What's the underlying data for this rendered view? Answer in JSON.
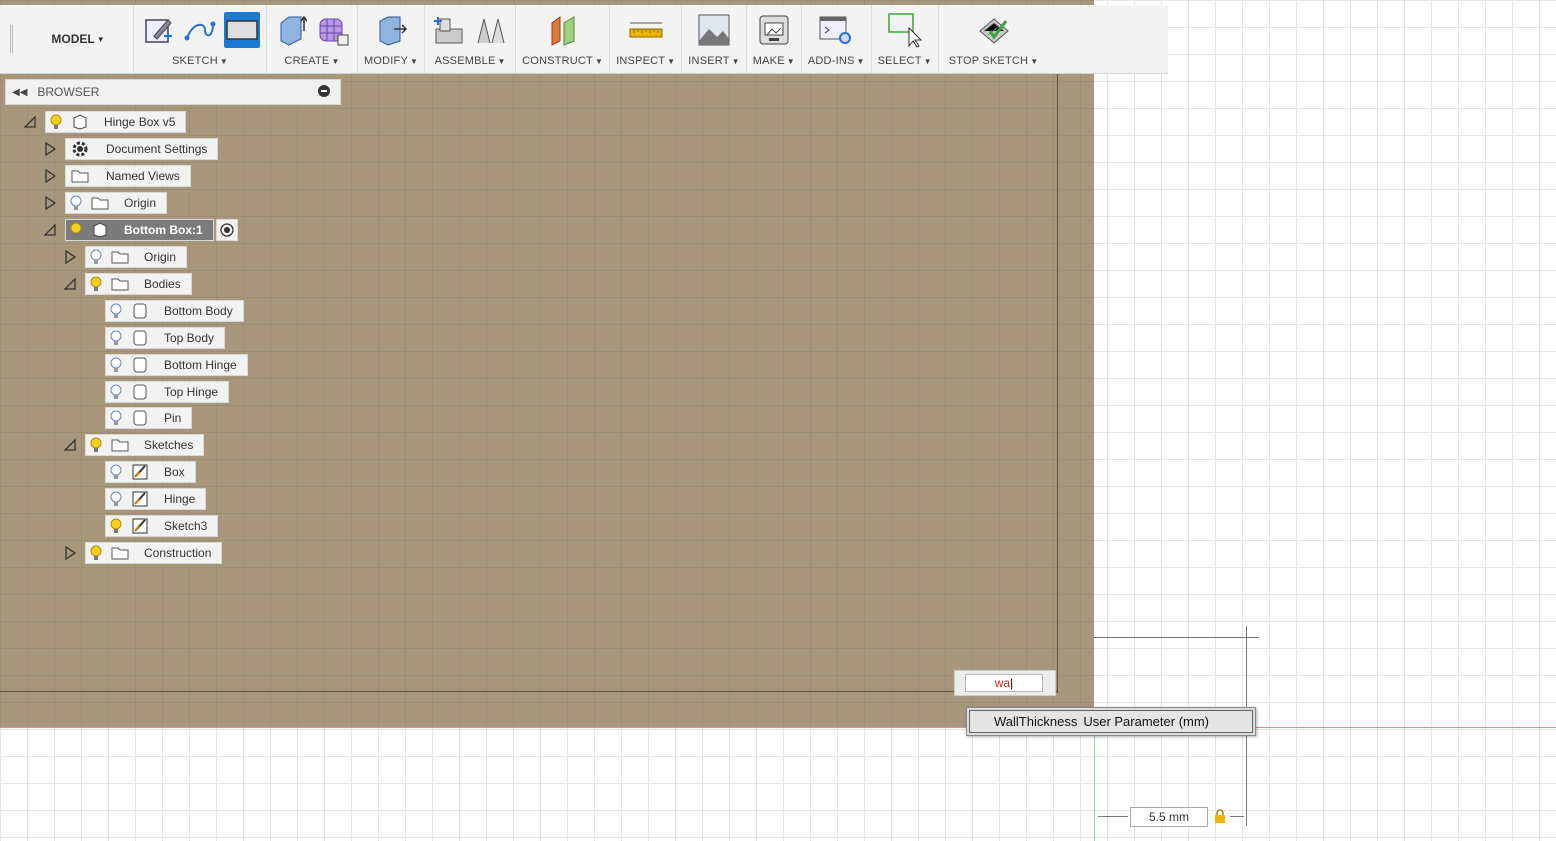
{
  "toolbar": {
    "workspace": "MODEL",
    "groups": [
      {
        "label": "SKETCH"
      },
      {
        "label": "CREATE"
      },
      {
        "label": "MODIFY"
      },
      {
        "label": "ASSEMBLE"
      },
      {
        "label": "CONSTRUCT"
      },
      {
        "label": "INSPECT"
      },
      {
        "label": "INSERT"
      },
      {
        "label": "MAKE"
      },
      {
        "label": "ADD-INS"
      },
      {
        "label": "SELECT"
      },
      {
        "label": "STOP SKETCH"
      }
    ]
  },
  "browser": {
    "title": "BROWSER",
    "nodes": [
      {
        "label": "Hinge Box v5"
      },
      {
        "label": "Document Settings"
      },
      {
        "label": "Named Views"
      },
      {
        "label": "Origin"
      },
      {
        "label": "Bottom Box:1"
      },
      {
        "label": "Origin"
      },
      {
        "label": "Bodies"
      },
      {
        "label": "Bottom Body"
      },
      {
        "label": "Top Body"
      },
      {
        "label": "Bottom Hinge"
      },
      {
        "label": "Top Hinge"
      },
      {
        "label": "Pin"
      },
      {
        "label": "Sketches"
      },
      {
        "label": "Box"
      },
      {
        "label": "Hinge"
      },
      {
        "label": "Sketch3"
      },
      {
        "label": "Construction"
      }
    ]
  },
  "dimension_input": {
    "value": "wa"
  },
  "suggestion": {
    "name": "WallThickness",
    "detail": "User Parameter (mm)"
  },
  "dimension_label": "5.5 mm",
  "colors": {
    "sketch_plane": "#a8977a",
    "accent": "#1b7bd3",
    "input_text": "#c62828"
  }
}
